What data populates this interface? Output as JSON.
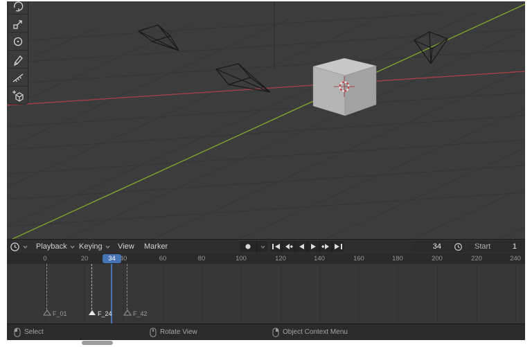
{
  "colors": {
    "accent_blue": "#4772b3",
    "axis_x_red": "#a04045",
    "axis_y_green": "#7fa52d",
    "viewport_bg": "#3c3c3c"
  },
  "toolbar": {
    "tools": [
      {
        "name": "rotate",
        "icon": "rotate-icon"
      },
      {
        "name": "scale",
        "icon": "scale-icon"
      },
      {
        "name": "transform",
        "icon": "transform-icon"
      },
      {
        "name": "annotate",
        "icon": "annotate-icon"
      },
      {
        "name": "measure",
        "icon": "measure-icon"
      },
      {
        "name": "add-cube",
        "icon": "add-cube-icon"
      }
    ]
  },
  "timeline": {
    "editor_icon": "clock-icon",
    "menus": {
      "playback": "Playback",
      "keying": "Keying",
      "view": "View",
      "marker": "Marker"
    },
    "transport": {
      "record_icon": "record-icon",
      "buttons": [
        "jump-to-start",
        "previous-keyframe",
        "play-reverse",
        "play",
        "next-keyframe",
        "jump-to-end"
      ]
    },
    "frame_field": {
      "value": "34"
    },
    "start_field": {
      "label": "Start",
      "value": "1"
    },
    "ruler_ticks": [
      "0",
      "20",
      "40",
      "60",
      "80",
      "100",
      "120",
      "140",
      "160",
      "180",
      "200",
      "220",
      "240"
    ],
    "playhead": {
      "frame": 34,
      "badge": "34"
    },
    "markers": [
      {
        "label": "F_01",
        "frame": 1,
        "selected": false
      },
      {
        "label": "F_24",
        "frame": 24,
        "selected": true
      },
      {
        "label": "F_42",
        "frame": 42,
        "selected": false
      }
    ]
  },
  "statusbar": {
    "items": [
      {
        "icon": "mouse-left-click-icon",
        "label": "Select"
      },
      {
        "icon": "mouse-middle-drag-icon",
        "label": "Rotate View"
      },
      {
        "icon": "mouse-right-click-icon",
        "label": "Object Context Menu"
      }
    ]
  }
}
